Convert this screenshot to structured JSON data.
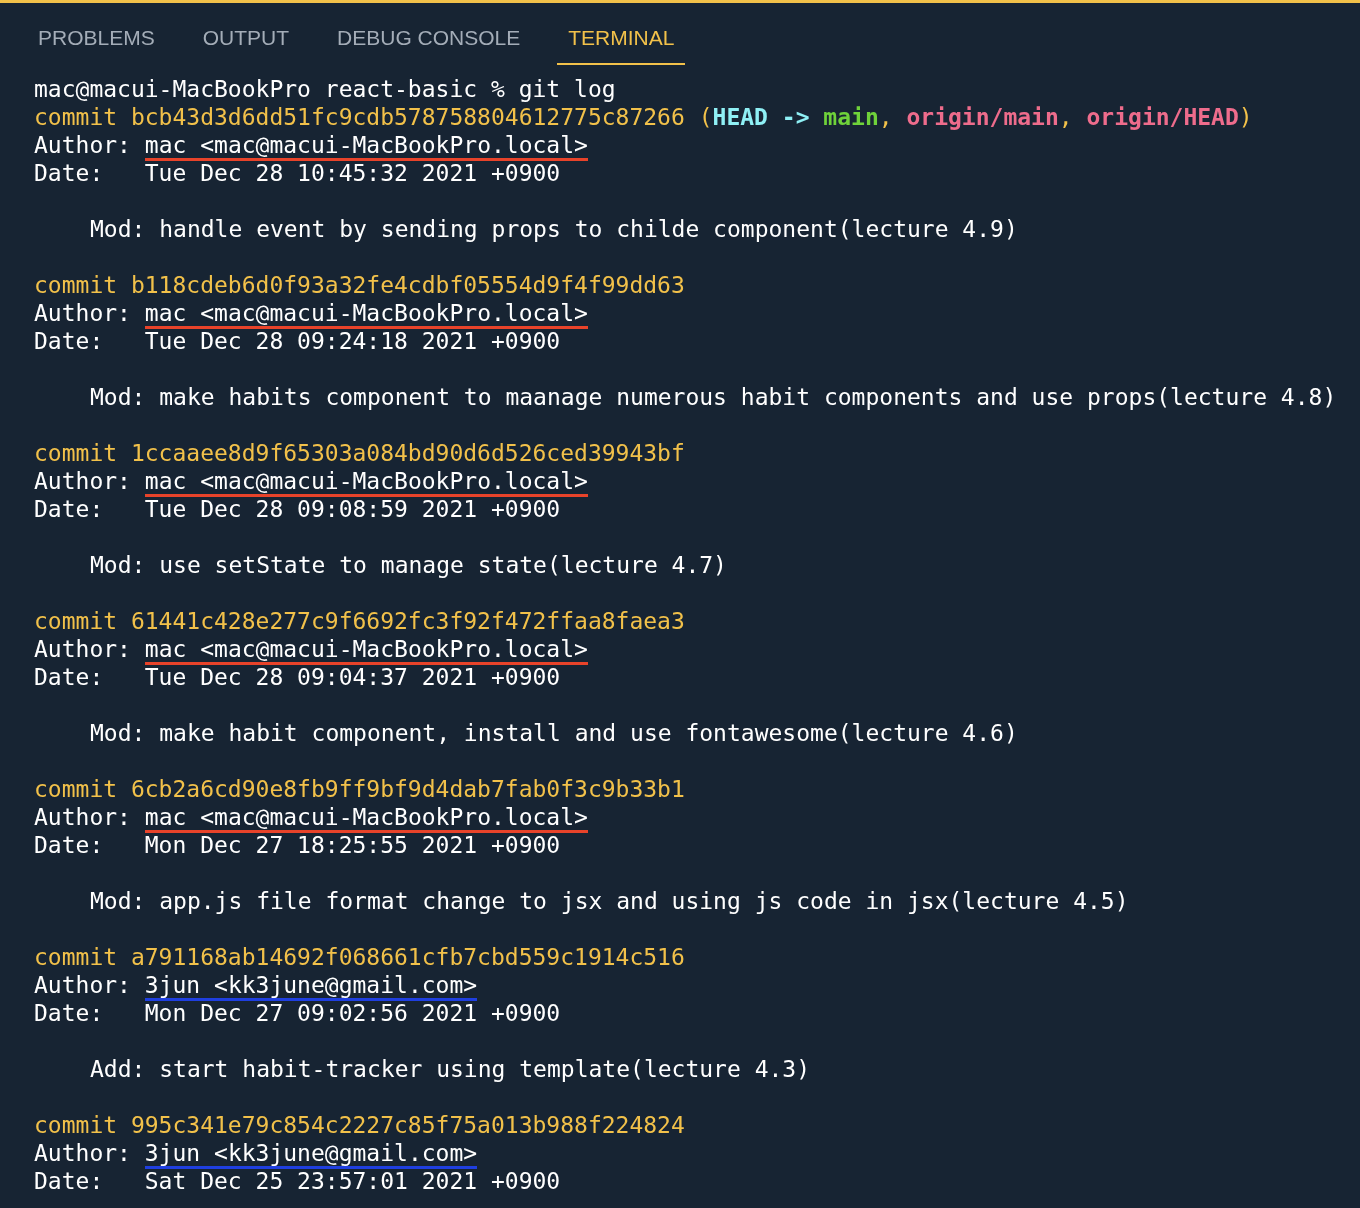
{
  "tabs": [
    {
      "label": "PROBLEMS",
      "selected": false
    },
    {
      "label": "OUTPUT",
      "selected": false
    },
    {
      "label": "DEBUG CONSOLE",
      "selected": false
    },
    {
      "label": "TERMINAL",
      "selected": true
    }
  ],
  "terminal": {
    "prompt": "mac@macui-MacBookPro react-basic % git log",
    "commits": [
      {
        "hash_line": "commit bcb43d3d6dd51fc9cdb578758804612775c87266",
        "refs": [
          {
            "text": "(",
            "kind": "punct"
          },
          {
            "text": "HEAD ->",
            "kind": "head"
          },
          {
            "text": "main",
            "kind": "local"
          },
          {
            "text": ",",
            "kind": "punct"
          },
          {
            "text": "origin/main",
            "kind": "remote"
          },
          {
            "text": ",",
            "kind": "punct"
          },
          {
            "text": "origin/HEAD",
            "kind": "remote"
          },
          {
            "text": ")",
            "kind": "punct"
          }
        ],
        "author_label": "Author:",
        "author": {
          "text": "mac <mac@macui-MacBookPro.local>",
          "color": "#e8432a"
        },
        "date": "Date:   Tue Dec 28 10:45:32 2021 +0900",
        "message": "Mod: handle event by sending props to childe component(lecture 4.9)"
      },
      {
        "hash_line": "commit b118cdeb6d0f93a32fe4cdbf05554d9f4f99dd63",
        "author_label": "Author:",
        "author": {
          "text": "mac <mac@macui-MacBookPro.local>",
          "color": "#e8432a"
        },
        "date": "Date:   Tue Dec 28 09:24:18 2021 +0900",
        "message": "Mod: make habits component to maanage numerous habit components and use props(lecture 4.8)"
      },
      {
        "hash_line": "commit 1ccaaee8d9f65303a084bd90d6d526ced39943bf",
        "author_label": "Author:",
        "author": {
          "text": "mac <mac@macui-MacBookPro.local>",
          "color": "#e8432a"
        },
        "date": "Date:   Tue Dec 28 09:08:59 2021 +0900",
        "message": "Mod: use setState to manage state(lecture 4.7)"
      },
      {
        "hash_line": "commit 61441c428e277c9f6692fc3f92f472ffaa8faea3",
        "author_label": "Author:",
        "author": {
          "text": "mac <mac@macui-MacBookPro.local>",
          "color": "#e8432a"
        },
        "date": "Date:   Tue Dec 28 09:04:37 2021 +0900",
        "message": "Mod: make habit component, install and use fontawesome(lecture 4.6)"
      },
      {
        "hash_line": "commit 6cb2a6cd90e8fb9ff9bf9d4dab7fab0f3c9b33b1",
        "author_label": "Author:",
        "author": {
          "text": "mac <mac@macui-MacBookPro.local>",
          "color": "#e8432a"
        },
        "date": "Date:   Mon Dec 27 18:25:55 2021 +0900",
        "message": "Mod: app.js file format change to jsx and using js code in jsx(lecture 4.5)"
      },
      {
        "hash_line": "commit a791168ab14692f068661cfb7cbd559c1914c516",
        "author_label": "Author:",
        "author": {
          "text": "3jun <kk3june@gmail.com>",
          "color": "#1f3fe0"
        },
        "date": "Date:   Mon Dec 27 09:02:56 2021 +0900",
        "message": "Add: start habit-tracker using template(lecture 4.3)"
      },
      {
        "hash_line": "commit 995c341e79c854c2227c85f75a013b988f224824",
        "author_label": "Author:",
        "author": {
          "text": "3jun <kk3june@gmail.com>",
          "color": "#1f3fe0"
        },
        "date": "Date:   Sat Dec 25 23:57:01 2021 +0900"
      }
    ]
  }
}
